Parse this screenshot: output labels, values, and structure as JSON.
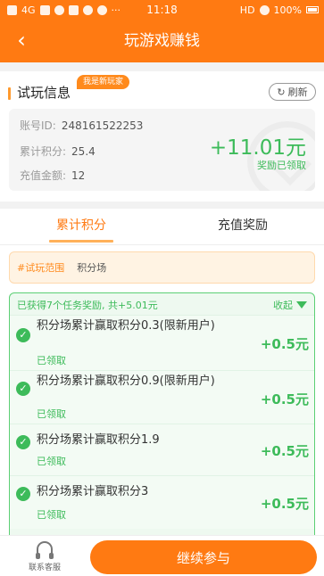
{
  "status_bar": {
    "network": "4G",
    "time": "11:18",
    "hd": "HD",
    "battery": "100%"
  },
  "header": {
    "title": "玩游戏赚钱",
    "back_icon": "‹"
  },
  "trial_info": {
    "heading": "试玩信息",
    "new_player_badge": "我是新玩家",
    "refresh_label": "刷新",
    "account_label": "账号ID:",
    "account_value": "248161522253",
    "points_label": "累计积分:",
    "points_value": "25.4",
    "recharge_label": "充值金额:",
    "recharge_value": "12",
    "reward_amount": "+11.01元",
    "reward_status": "奖励已领取"
  },
  "tabs": [
    {
      "label": "累计积分",
      "active": true
    },
    {
      "label": "充值奖励",
      "active": false
    }
  ],
  "scope": {
    "tag": "#试玩范围",
    "name": "积分场"
  },
  "task_list": {
    "summary": "已获得7个任务奖励, 共+5.01元",
    "collapse_label": "收起",
    "items": [
      {
        "title": "积分场累计赢取积分0.3(限新用户)",
        "status": "已领取",
        "amount": "+0.5元"
      },
      {
        "title": "积分场累计赢取积分0.9(限新用户)",
        "status": "已领取",
        "amount": "+0.5元"
      },
      {
        "title": "积分场累计赢取积分1.9",
        "status": "已领取",
        "amount": "+0.5元"
      },
      {
        "title": "积分场累计赢取积分3",
        "status": "已领取",
        "amount": "+0.5元"
      }
    ]
  },
  "bottom_bar": {
    "customer_service_label": "联系客服",
    "continue_label": "继续参与"
  },
  "colors": {
    "brand": "#ff7a12",
    "success": "#3dbb5a"
  }
}
